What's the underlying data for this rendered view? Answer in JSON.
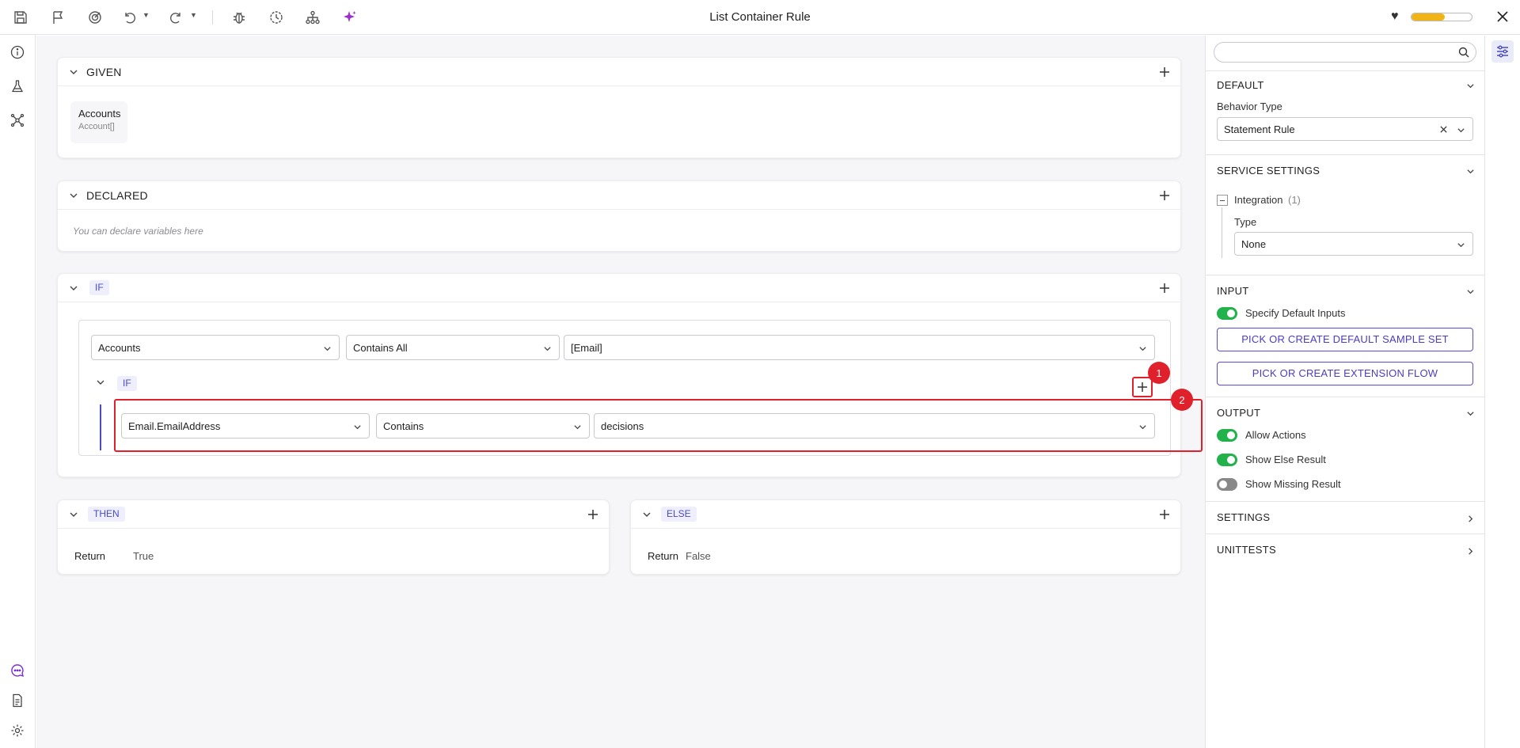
{
  "window": {
    "title": "List Container Rule"
  },
  "status": {
    "progress_percent": 55,
    "accent_color": "#f1b416"
  },
  "toolbar": {
    "icons": [
      "save-icon",
      "flag-icon",
      "target-icon",
      "undo-icon",
      "redo-icon",
      "bug-icon",
      "history-icon",
      "hierarchy-icon",
      "sparkle-icon"
    ]
  },
  "leftrail": {
    "top_icons": [
      "info-icon",
      "flask-icon",
      "network-icon"
    ],
    "bottom_icons": [
      "chat-icon",
      "document-icon",
      "settings-icon"
    ]
  },
  "given": {
    "title": "GIVEN",
    "items": [
      {
        "name": "Accounts",
        "type": "Account[]"
      }
    ]
  },
  "declared": {
    "title": "DECLARED",
    "hint": "You can declare variables here"
  },
  "if_block": {
    "chip": "IF",
    "condition": {
      "field": "Accounts",
      "operator": "Contains All",
      "value": "[Email]"
    },
    "nested": {
      "chip": "IF",
      "condition": {
        "field": "Email.EmailAddress",
        "operator": "Contains",
        "value": "decisions"
      }
    },
    "badges": [
      "1",
      "2"
    ],
    "highlight_color": "#e0202a"
  },
  "then_block": {
    "chip": "THEN",
    "return_label": "Return",
    "return_value": "True"
  },
  "else_block": {
    "chip": "ELSE",
    "return_label": "Return",
    "return_value": "False"
  },
  "right_panel": {
    "search": {
      "placeholder": ""
    },
    "default": {
      "title": "DEFAULT",
      "behavior_label": "Behavior Type",
      "behavior_value": "Statement Rule"
    },
    "service_settings": {
      "title": "SERVICE SETTINGS",
      "integration_label": "Integration",
      "integration_count": "(1)",
      "type_label": "Type",
      "type_value": "None"
    },
    "input": {
      "title": "INPUT",
      "specify_default_inputs": {
        "label": "Specify Default Inputs",
        "on": true
      },
      "btn_sample_set": "PICK OR CREATE DEFAULT SAMPLE SET",
      "btn_extension_flow": "PICK OR CREATE EXTENSION FLOW"
    },
    "output": {
      "title": "OUTPUT",
      "allow_actions": {
        "label": "Allow Actions",
        "on": true
      },
      "show_else_result": {
        "label": "Show Else Result",
        "on": true
      },
      "show_missing_result": {
        "label": "Show Missing Result",
        "on": false
      }
    },
    "settings": {
      "title": "SETTINGS"
    },
    "unittests": {
      "title": "UNITTESTS"
    }
  }
}
